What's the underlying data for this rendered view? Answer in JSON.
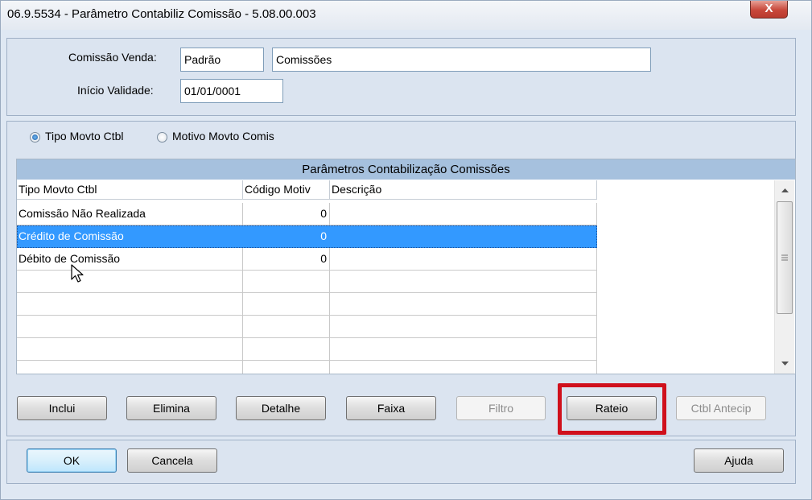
{
  "window": {
    "title": "06.9.5534 - Parâmetro Contabiliz Comissão - 5.08.00.003",
    "close_label": "X"
  },
  "header": {
    "comissao_label": "Comissão Venda:",
    "comissao_code": "Padrão",
    "comissao_desc": "Comissões",
    "inicio_label": "Início Validade:",
    "inicio_value": "01/01/0001"
  },
  "filter": {
    "option1": "Tipo Movto Ctbl",
    "option2": "Motivo Movto Comis",
    "selected": "Tipo Movto Ctbl"
  },
  "grid": {
    "title": "Parâmetros Contabilização Comissões",
    "columns": [
      "Tipo Movto Ctbl",
      "Código Motiv",
      "Descrição"
    ],
    "rows": [
      {
        "tipo": "Comissão Não Realizada",
        "codigo": "0",
        "descricao": ""
      },
      {
        "tipo": "Crédito de Comissão",
        "codigo": "0",
        "descricao": ""
      },
      {
        "tipo": "Débito de Comissão",
        "codigo": "0",
        "descricao": ""
      }
    ],
    "selected_row": 1
  },
  "actions": {
    "inclui": "Inclui",
    "elimina": "Elimina",
    "detalhe": "Detalhe",
    "faixa": "Faixa",
    "filtro": "Filtro",
    "rateio": "Rateio",
    "ctbl_antecip": "Ctbl Antecip"
  },
  "footer": {
    "ok": "OK",
    "cancela": "Cancela",
    "ajuda": "Ajuda"
  },
  "colors": {
    "grid_title_bg": "#a6c1de",
    "selection": "#3399ff",
    "highlight_border": "#d0101c"
  }
}
